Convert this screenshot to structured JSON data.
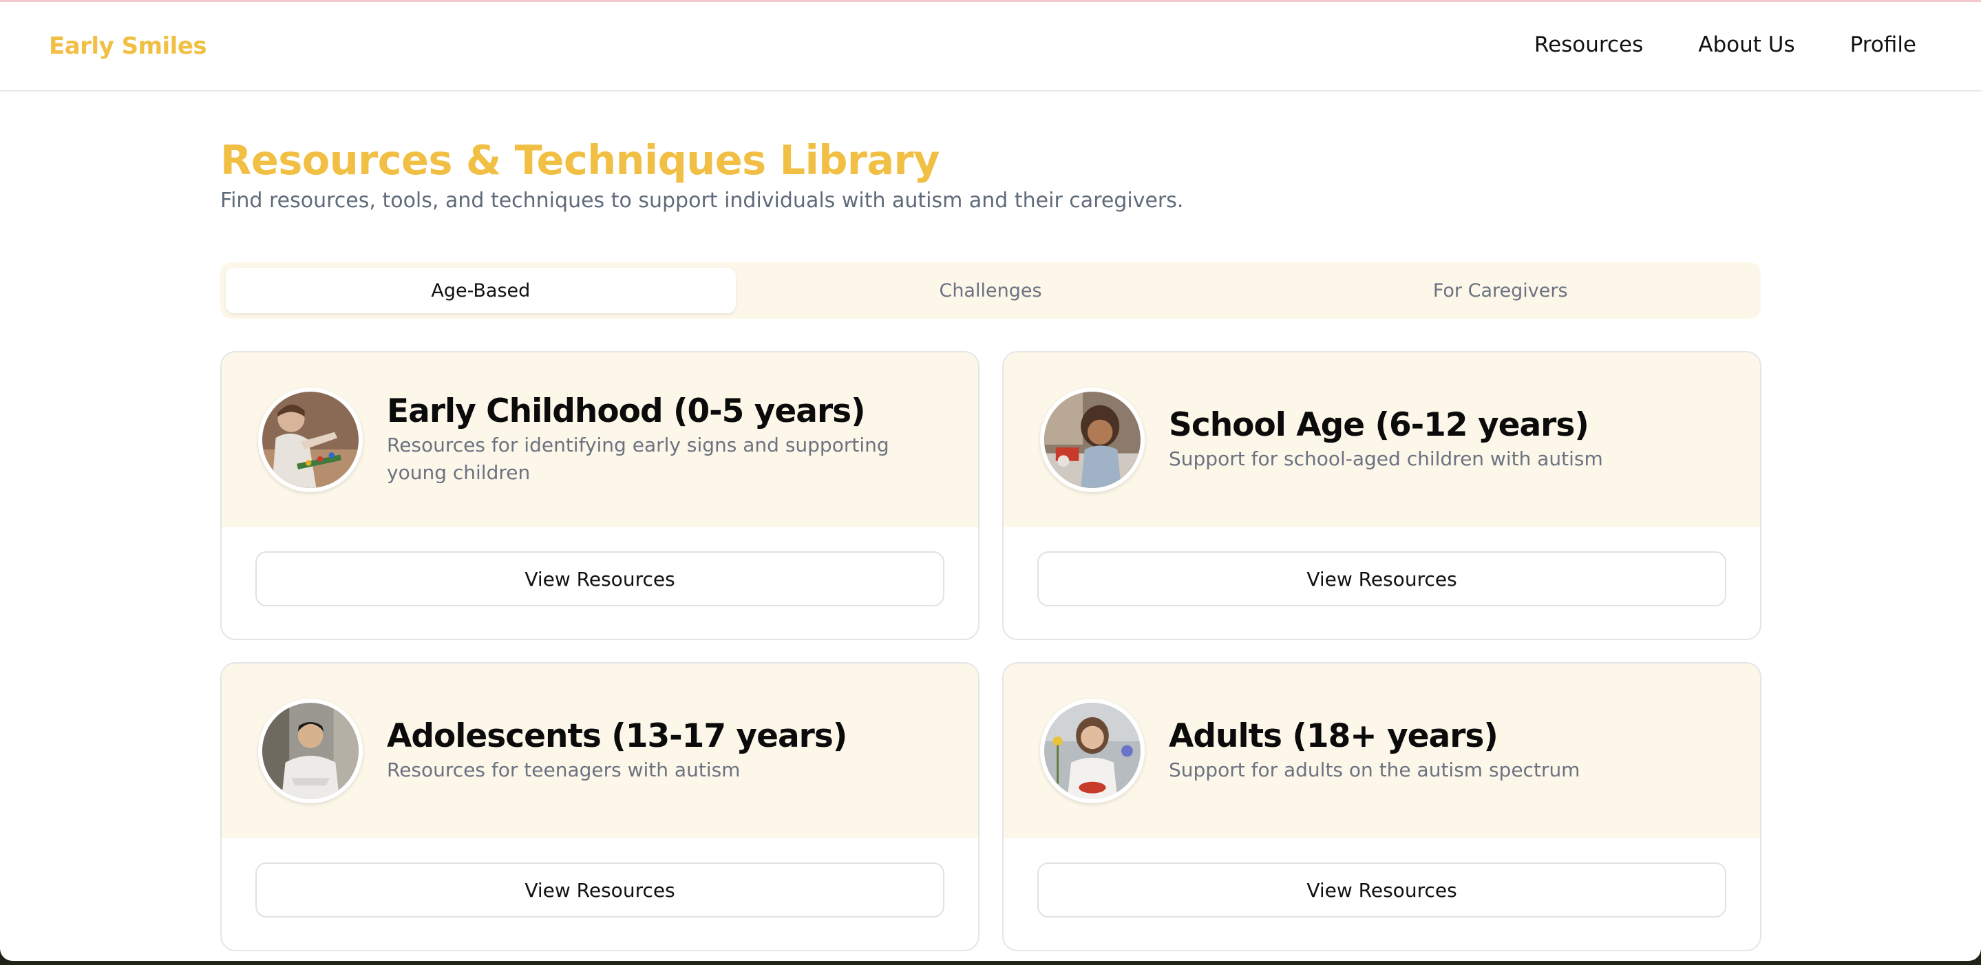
{
  "nav": {
    "brand": "Early Smiles",
    "links": [
      "Resources",
      "About Us",
      "Profile"
    ]
  },
  "page": {
    "title": "Resources & Techniques Library",
    "subtitle": "Find resources, tools, and techniques to support individuals with autism and their caregivers."
  },
  "tabs": [
    {
      "label": "Age-Based",
      "active": true
    },
    {
      "label": "Challenges",
      "active": false
    },
    {
      "label": "For Caregivers",
      "active": false
    }
  ],
  "cards": [
    {
      "title": "Early Childhood (0-5 years)",
      "description": "Resources for identifying early signs and supporting young children",
      "button": "View Resources",
      "image": "toddler-playing-photo"
    },
    {
      "title": "School Age (6-12 years)",
      "description": "Support for school-aged children with autism",
      "button": "View Resources",
      "image": "child-at-table-photo"
    },
    {
      "title": "Adolescents (13-17 years)",
      "description": "Resources for teenagers with autism",
      "button": "View Resources",
      "image": "teenager-portrait-photo"
    },
    {
      "title": "Adults (18+ years)",
      "description": "Support for adults on the autism spectrum",
      "button": "View Resources",
      "image": "adult-portrait-photo"
    }
  ],
  "colors": {
    "accent": "#f0bf44",
    "card_header_bg": "#fdf7ea",
    "muted_text": "#6b7280"
  }
}
